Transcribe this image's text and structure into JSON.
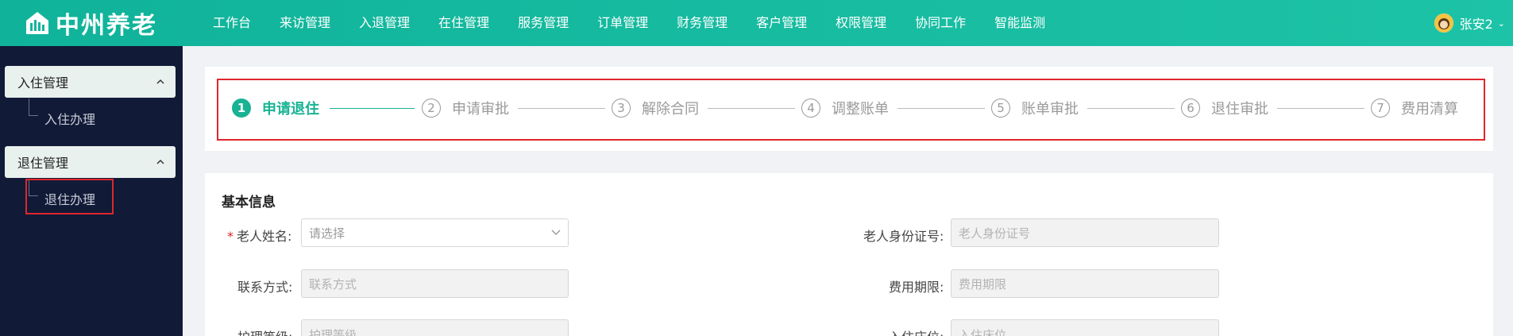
{
  "app": {
    "logo_text": "中州养老",
    "user_name": "张安2"
  },
  "nav": {
    "items": [
      "工作台",
      "来访管理",
      "入退管理",
      "在住管理",
      "服务管理",
      "订单管理",
      "财务管理",
      "客户管理",
      "权限管理",
      "协同工作",
      "智能监测"
    ]
  },
  "sidebar": {
    "groups": [
      {
        "title": "入住管理",
        "items": [
          "入住办理"
        ]
      },
      {
        "title": "退住管理",
        "items": [
          "退住办理"
        ]
      }
    ]
  },
  "steps": {
    "current": 1,
    "items": [
      {
        "num": "1",
        "label": "申请退住"
      },
      {
        "num": "2",
        "label": "申请审批"
      },
      {
        "num": "3",
        "label": "解除合同"
      },
      {
        "num": "4",
        "label": "调整账单"
      },
      {
        "num": "5",
        "label": "账单审批"
      },
      {
        "num": "6",
        "label": "退住审批"
      },
      {
        "num": "7",
        "label": "费用清算"
      }
    ]
  },
  "form": {
    "section_title": "基本信息",
    "required_mark": "*",
    "fields": {
      "elder_name": {
        "label": "老人姓名:",
        "placeholder": "请选择"
      },
      "elder_id": {
        "label": "老人身份证号:",
        "placeholder": "老人身份证号"
      },
      "contact": {
        "label": "联系方式:",
        "placeholder": "联系方式"
      },
      "fee_period": {
        "label": "费用期限:",
        "placeholder": "费用期限"
      },
      "care_level": {
        "label": "护理等级:",
        "placeholder": "护理等级"
      },
      "bed": {
        "label": "入住床位:",
        "placeholder": "入住床位"
      }
    }
  },
  "colors": {
    "brand": "#19b394",
    "sidebar_bg": "#111a37",
    "highlight_border": "#e0262d"
  }
}
